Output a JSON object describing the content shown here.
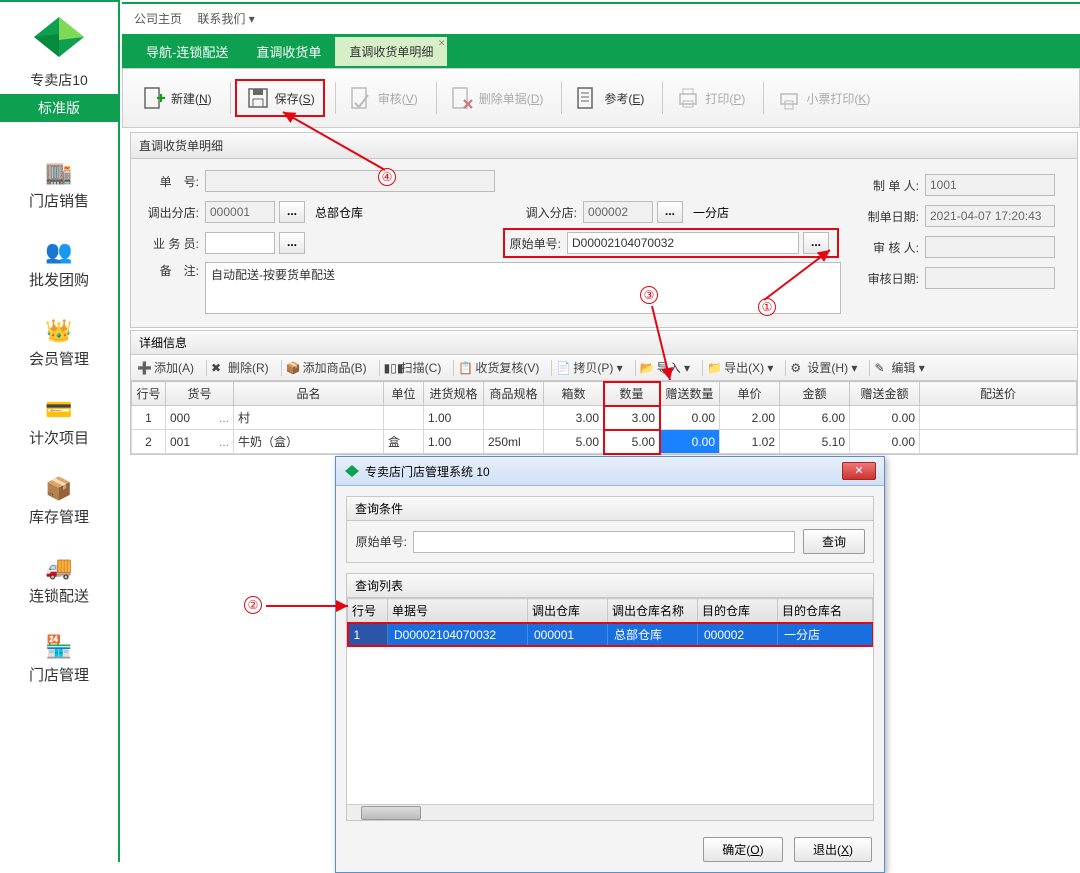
{
  "sidebar": {
    "store_name": "专卖店10",
    "edition": "标准版",
    "items": [
      {
        "label": "门店销售"
      },
      {
        "label": "批发团购"
      },
      {
        "label": "会员管理"
      },
      {
        "label": "计次项目"
      },
      {
        "label": "库存管理"
      },
      {
        "label": "连锁配送"
      },
      {
        "label": "门店管理"
      }
    ]
  },
  "topmenu": {
    "home": "公司主页",
    "contact": "联系我们 ▾"
  },
  "tabs": {
    "t1": "导航-连锁配送",
    "t2": "直调收货单",
    "t3": "直调收货单明细"
  },
  "toolbar": {
    "new": "新建(",
    "new_k": "N",
    "new2": ")",
    "save": "保存(",
    "save_k": "S",
    "save2": ")",
    "audit": "审核(",
    "audit_k": "V",
    "audit2": ")",
    "del": "删除单据(",
    "del_k": "D",
    "del2": ")",
    "ref": "参考(",
    "ref_k": "E",
    "ref2": ")",
    "print": "打印(",
    "print_k": "P",
    "print2": ")",
    "ticket": "小票打印(",
    "ticket_k": "K",
    "ticket2": ")"
  },
  "form": {
    "panel_title": "直调收货单明细",
    "l_orderno": "单　号:",
    "l_out": "调出分店:",
    "out_code": "000001",
    "out_name": "总部仓库",
    "l_in": "调入分店:",
    "in_code": "000002",
    "in_name": "一分店",
    "l_sales": "业 务 员:",
    "sales": "",
    "l_orig": "原始单号:",
    "orig_no": "D00002104070032",
    "l_remark": "备　注:",
    "remark": "自动配送-按要货单配送",
    "l_maker": "制 单 人:",
    "maker": "1001",
    "l_mdate": "制单日期:",
    "mdate": "2021-04-07 17:20:43",
    "l_auditor": "审 核 人:",
    "auditor": "",
    "l_adate": "审核日期:",
    "adate": ""
  },
  "detail": {
    "title": "详细信息",
    "bar": {
      "add": "添加(A)",
      "del": "删除(R)",
      "addp": "添加商品(B)",
      "scan": "扫描(C)",
      "recheck": "收货复核(V)",
      "copy": "拷贝(P) ▾",
      "import": "导入 ▾",
      "export": "导出(X) ▾",
      "setting": "设置(H) ▾",
      "edit": "编辑 ▾"
    },
    "headers": [
      "行号",
      "货号",
      "品名",
      "单位",
      "进货规格",
      "商品规格",
      "箱数",
      "数量",
      "赠送数量",
      "单价",
      "金额",
      "赠送金额",
      "配送价"
    ],
    "rows": [
      {
        "rn": "1",
        "code": "000",
        "dots": "...",
        "name": "村",
        "unit": "",
        "inspec": "1.00",
        "spec": "",
        "box": "3.00",
        "qty": "3.00",
        "gift": "0.00",
        "price": "2.00",
        "amount": "6.00",
        "gamt": "0.00",
        "dp": ""
      },
      {
        "rn": "2",
        "code": "001",
        "dots": "...",
        "name": "牛奶（盒）",
        "unit": "盒",
        "inspec": "1.00",
        "spec": "250ml",
        "box": "5.00",
        "qty": "5.00",
        "gift": "0.00",
        "price": "1.02",
        "amount": "5.10",
        "gamt": "0.00",
        "dp": ""
      }
    ]
  },
  "dialog": {
    "title": "专卖店门店管理系统 10",
    "cond_title": "查询条件",
    "l_orig": "原始单号:",
    "btn_query": "查询",
    "list_title": "查询列表",
    "headers": [
      "行号",
      "单据号",
      "调出仓库",
      "调出仓库名称",
      "目的仓库",
      "目的仓库名"
    ],
    "row": {
      "rn": "1",
      "billno": "D00002104070032",
      "outc": "000001",
      "outn": "总部仓库",
      "inc": "000002",
      "inn": "一分店"
    },
    "btn_ok": "确定(",
    "ok_k": "O",
    "btn_ok2": ")",
    "btn_exit": "退出(",
    "exit_k": "X",
    "btn_exit2": ")"
  },
  "anno": {
    "n1": "①",
    "n2": "②",
    "n3": "③",
    "n4": "④"
  }
}
